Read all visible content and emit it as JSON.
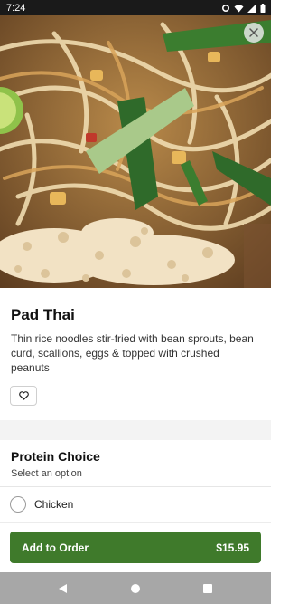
{
  "status_bar": {
    "time": "7:24"
  },
  "hero": {
    "image_name": "pad-thai-photo"
  },
  "item": {
    "title": "Pad Thai",
    "description": "Thin rice noodles stir-fried with bean sprouts, bean curd, scallions, eggs & topped with crushed peanuts"
  },
  "options": {
    "title": "Protein Choice",
    "subtitle": "Select an option",
    "items": [
      {
        "label": "Chicken",
        "selected": false
      }
    ]
  },
  "footer": {
    "add_label": "Add to Order",
    "price": "$15.95"
  },
  "colors": {
    "accent": "#3f7a2b",
    "nav_bar": "#a7a7a7",
    "status_bar": "#1a1a1a"
  }
}
